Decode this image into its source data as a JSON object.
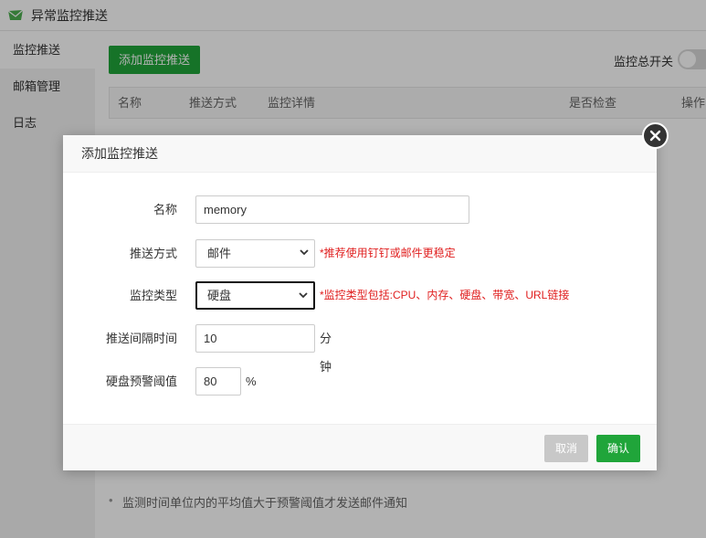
{
  "window": {
    "title": "异常监控推送",
    "icon": "envelope-icon"
  },
  "sidebar": {
    "items": [
      {
        "label": "监控推送",
        "active": true
      },
      {
        "label": "邮箱管理",
        "active": false
      },
      {
        "label": "日志",
        "active": false
      }
    ]
  },
  "toolbar": {
    "add_label": "添加监控推送",
    "master_switch_label": "监控总开关",
    "master_switch_on": false
  },
  "table": {
    "headers": [
      "名称",
      "推送方式",
      "监控详情",
      "是否检查",
      "操作"
    ]
  },
  "hint": "监测时间单位内的平均值大于预警阈值才发送邮件通知",
  "modal": {
    "title": "添加监控推送",
    "fields": {
      "name": {
        "label": "名称",
        "value": "memory"
      },
      "push_method": {
        "label": "推送方式",
        "value": "邮件",
        "note": "*推荐使用钉钉或邮件更稳定"
      },
      "monitor_type": {
        "label": "监控类型",
        "value": "硬盘",
        "note": "*监控类型包括:CPU、内存、硬盘、带宽、URL链接"
      },
      "interval": {
        "label": "推送间隔时间",
        "value": "10",
        "unit": "分钟"
      },
      "threshold": {
        "label": "硬盘预警阈值",
        "value": "80",
        "unit": "%"
      }
    },
    "cancel_label": "取消",
    "confirm_label": "确认"
  },
  "colors": {
    "accent": "#20a53a",
    "warning": "#e02020"
  }
}
